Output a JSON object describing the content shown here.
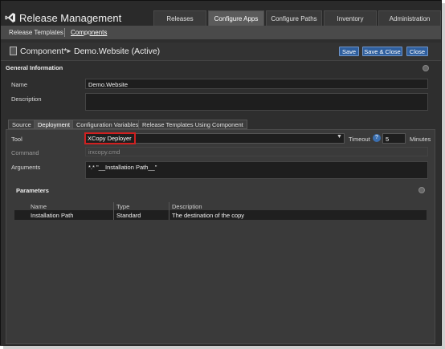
{
  "app": {
    "title": "Release Management"
  },
  "nav": {
    "tabs": [
      {
        "label": "Releases"
      },
      {
        "label": "Configure Apps"
      },
      {
        "label": "Configure Paths"
      },
      {
        "label": "Inventory"
      },
      {
        "label": "Administration"
      }
    ],
    "active": "Configure Apps"
  },
  "subnav": {
    "items": [
      {
        "label": "Release Templates"
      },
      {
        "label": "Components"
      }
    ],
    "active": "Components"
  },
  "header": {
    "breadcrumb_root": "Component*",
    "breadcrumb_arrow": "►",
    "entity": "Demo.Website (Active)",
    "buttons": {
      "save": "Save",
      "save_close": "Save & Close",
      "close": "Close"
    }
  },
  "general": {
    "title": "General Information",
    "name_label": "Name",
    "name_value": "Demo.Website",
    "description_label": "Description",
    "description_value": ""
  },
  "tabs": [
    {
      "label": "Source"
    },
    {
      "label": "Deployment"
    },
    {
      "label": "Configuration Variables"
    },
    {
      "label": "Release Templates Using Component"
    }
  ],
  "deployment": {
    "tool_label": "Tool",
    "tool_value": "XCopy Deployer",
    "timeout_label": "Timeout",
    "timeout_help": "?",
    "timeout_value": "5",
    "timeout_unit": "Minutes",
    "command_label": "Command",
    "command_value": "irxcopy.cmd",
    "arguments_label": "Arguments",
    "arguments_value": "*.* \"__Installation Path__\""
  },
  "parameters": {
    "title": "Parameters",
    "columns": [
      "Name",
      "Type",
      "Description"
    ],
    "rows": [
      {
        "name": "Installation Path",
        "type": "Standard",
        "description": "The destination of the copy"
      }
    ]
  },
  "colors": {
    "accent": "#2f5f9e",
    "highlight": "#d12020",
    "background": "#2e2e2e"
  }
}
